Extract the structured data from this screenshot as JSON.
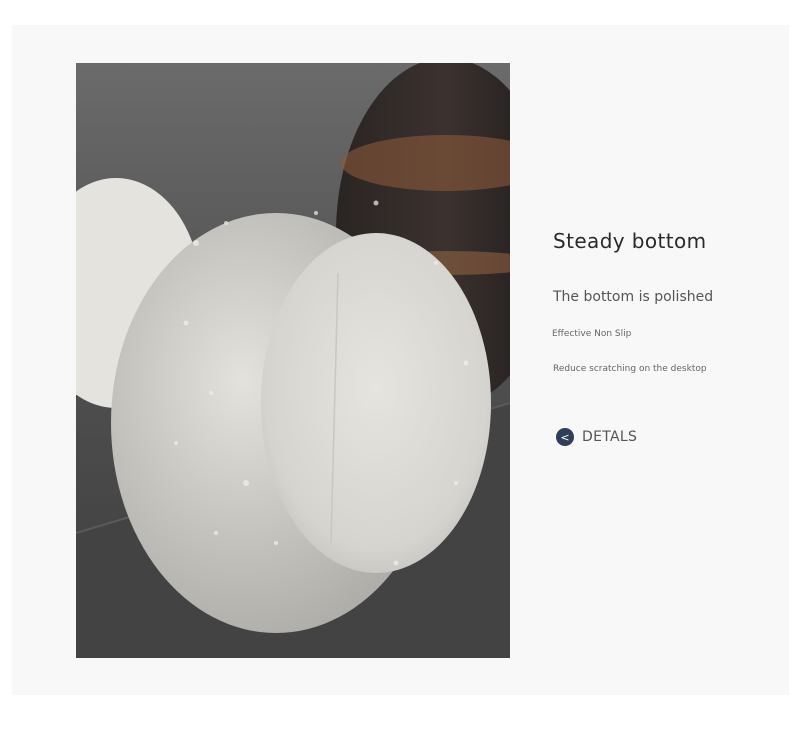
{
  "product": {
    "title": "Steady bottom",
    "subtitle": "The bottom is polished",
    "features": [
      "Effective Non Slip",
      "Reduce scratching on the desktop"
    ],
    "details_label": "DETALS",
    "details_icon": "chevron-left-icon"
  },
  "colors": {
    "panel_background": "#f8f8f8",
    "details_icon_background": "#2e3f57",
    "title_text": "#2a2a2a"
  }
}
